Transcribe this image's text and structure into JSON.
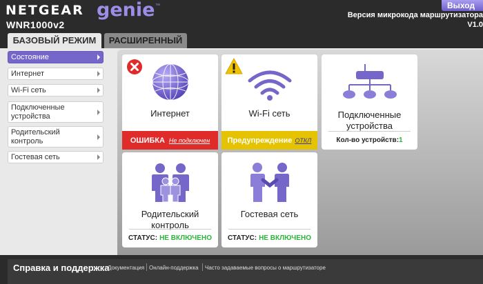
{
  "header": {
    "brand": "NETGEAR",
    "genie": "genie",
    "tm": "™",
    "model": "WNR1000v2",
    "logout": "Выход",
    "firmware_label": "Версия микрокода маршрутизатора",
    "firmware_value": "V1.0"
  },
  "tabs": [
    {
      "label": "БАЗОВЫЙ РЕЖИМ"
    },
    {
      "label": "РАСШИРЕННЫЙ"
    }
  ],
  "sidebar": {
    "items": [
      {
        "label": "Состояние"
      },
      {
        "label": "Интернет"
      },
      {
        "label": "Wi-Fi сеть"
      },
      {
        "label": "Подключенные устройства"
      },
      {
        "label": "Родительский контроль"
      },
      {
        "label": "Гостевая сеть"
      }
    ]
  },
  "tiles": {
    "internet": {
      "title": "Интернет",
      "status_label": "ОШИБКА",
      "status_link": "Не подключен"
    },
    "wifi": {
      "title": "Wi-Fi сеть",
      "status_label": "Предупреждение",
      "status_link": "ОТКЛ"
    },
    "devices": {
      "title": "Подключенные устройства",
      "status_label": "Кол-во устройств:",
      "status_value": "1"
    },
    "parental": {
      "title": "Родительский контроль",
      "status_label": "СТАТУС:",
      "status_value": "НЕ ВКЛЮЧЕНО"
    },
    "guest": {
      "title": "Гостевая сеть",
      "status_label": "СТАТУС:",
      "status_value": "НЕ ВКЛЮЧЕНО"
    }
  },
  "footer": {
    "title": "Справка и поддержка",
    "links": [
      "Документация",
      "Онлайн-поддержка",
      "Часто задаваемые вопросы о маршрутизаторе"
    ]
  },
  "colors": {
    "accent": "#7566c9",
    "error": "#e02b2b",
    "warning": "#e5c300",
    "ok": "#2bb33b"
  }
}
